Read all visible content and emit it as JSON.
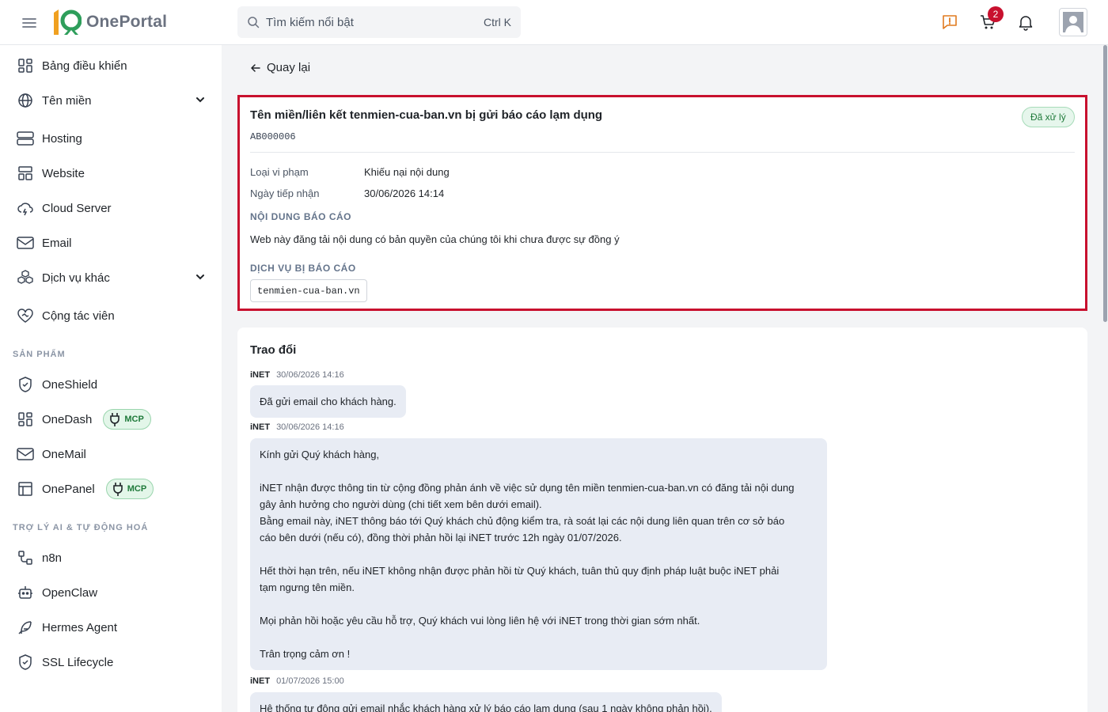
{
  "header": {
    "logo_mark": "10",
    "logo_text": "OnePortal",
    "search_placeholder": "Tìm kiếm nổi bật",
    "search_shortcut": "Ctrl K",
    "cart_count": "2"
  },
  "sidebar": {
    "items": [
      {
        "label": "Bảng điều khiển",
        "icon": "dashboard-icon"
      },
      {
        "label": "Tên miền",
        "icon": "globe-icon",
        "expandable": true
      },
      {
        "label": "Hosting",
        "icon": "server-icon"
      },
      {
        "label": "Website",
        "icon": "layout-icon"
      },
      {
        "label": "Cloud Server",
        "icon": "cloud-icon"
      },
      {
        "label": "Email",
        "icon": "mail-icon"
      },
      {
        "label": "Dịch vụ khác",
        "icon": "boxes-icon",
        "expandable": true
      },
      {
        "label": "Cộng tác viên",
        "icon": "handshake-icon"
      }
    ],
    "products_title": "SẢN PHẨM",
    "products": [
      {
        "label": "OneShield",
        "icon": "shield-icon"
      },
      {
        "label": "OneDash",
        "icon": "dashboard-icon",
        "badge": "MCP"
      },
      {
        "label": "OneMail",
        "icon": "mail-icon"
      },
      {
        "label": "OnePanel",
        "icon": "panel-icon",
        "badge": "MCP"
      }
    ],
    "ai_title": "TRỢ LÝ AI & TỰ ĐỘNG HOÁ",
    "ai_items": [
      {
        "label": "n8n",
        "icon": "workflow-icon"
      },
      {
        "label": "OpenClaw",
        "icon": "bot-icon"
      },
      {
        "label": "Hermes Agent",
        "icon": "feather-icon"
      },
      {
        "label": "SSL Lifecycle",
        "icon": "shield-check-icon"
      }
    ]
  },
  "main": {
    "back_label": "Quay lại",
    "report": {
      "title": "Tên miền/liên kết tenmien-cua-ban.vn bị gửi báo cáo lạm dụng",
      "code": "AB000006",
      "status": "Đã xử lý",
      "violation_label": "Loại vi phạm",
      "violation_value": "Khiếu nại nội dung",
      "received_label": "Ngày tiếp nhận",
      "received_value": "30/06/2026 14:14",
      "content_heading": "NỘI DUNG BÁO CÁO",
      "content_text": "Web này đăng tải nội dung có bản quyền của chúng tôi khi chưa được sự đồng ý",
      "service_heading": "DỊCH VỤ BỊ BÁO CÁO",
      "service_value": "tenmien-cua-ban.vn"
    },
    "exchange": {
      "title": "Trao đổi",
      "messages": [
        {
          "author": "iNET",
          "time": "30/06/2026 14:16",
          "lines": [
            "Đã gửi email cho khách hàng."
          ]
        },
        {
          "author": "iNET",
          "time": "30/06/2026 14:16",
          "lines": [
            "Kính gửi Quý khách hàng,",
            "",
            "iNET nhận được thông tin từ cộng đồng phản ánh về việc sử dụng tên miền tenmien-cua-ban.vn có đăng tải nội dung",
            "gây ảnh hưởng cho người dùng (chi tiết xem bên dưới email).",
            "Bằng email này, iNET thông báo tới Quý khách chủ động kiểm tra, rà soát lại các nội dung liên quan trên cơ sở báo",
            "cáo bên dưới (nếu có), đồng thời phản hồi lại iNET trước 12h ngày 01/07/2026.",
            "",
            "Hết thời hạn trên, nếu iNET không nhận được phản hồi từ Quý khách, tuân thủ quy định pháp luật buộc iNET phải",
            "tạm ngưng tên miền.",
            "",
            "Mọi phản hồi hoặc yêu cầu hỗ trợ, Quý khách vui lòng liên hệ với iNET trong thời gian sớm nhất.",
            "",
            "Trân trọng cảm ơn !"
          ]
        },
        {
          "author": "iNET",
          "time": "01/07/2026 15:00",
          "lines": [
            "Hệ thống tự động gửi email nhắc khách hàng xử lý báo cáo lạm dụng (sau 1 ngày không phản hồi)."
          ]
        }
      ]
    }
  },
  "colors": {
    "accent_red": "#c8102e",
    "status_green": "#1f7a3a",
    "logo_green": "#2e9e5b",
    "logo_orange": "#f0a020"
  }
}
